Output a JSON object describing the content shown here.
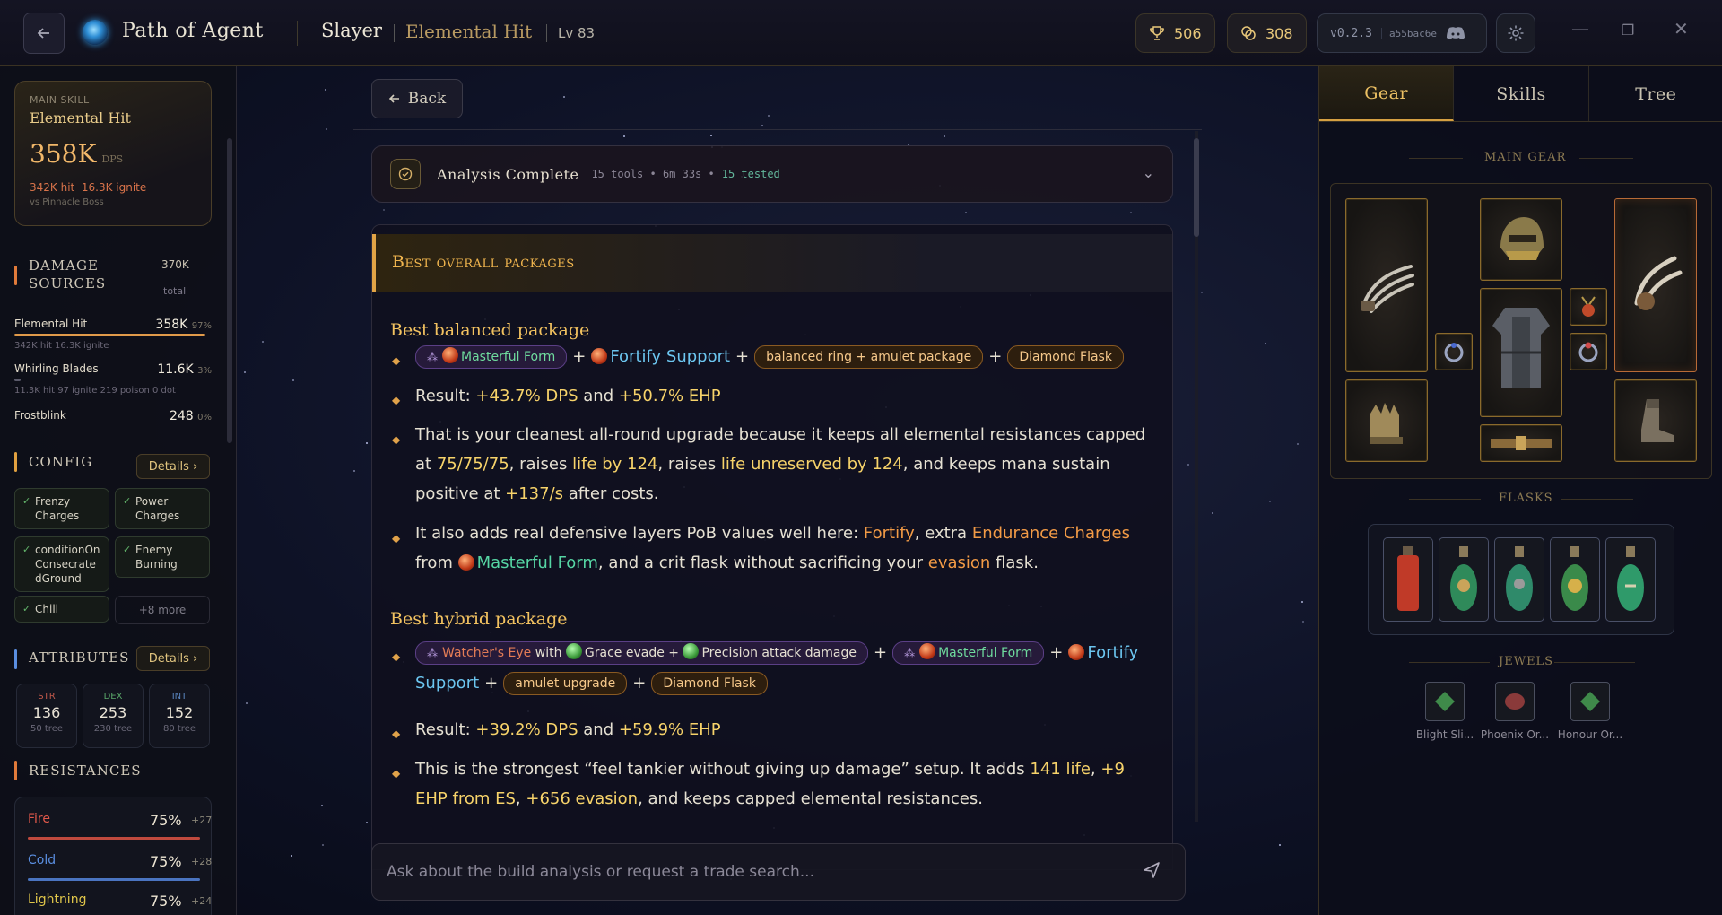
{
  "topbar": {
    "app_title": "Path of Agent",
    "class_name": "Slayer",
    "skill_name": "Elemental Hit",
    "level": "Lv 83",
    "trophy_count": "506",
    "coin_count": "308",
    "version": "v0.2.3",
    "hash": "a55bac6e",
    "icons": {
      "back": "arrow-left-icon",
      "trophy": "trophy-icon",
      "coins": "coins-icon",
      "discord": "discord-icon",
      "settings": "gear-icon"
    }
  },
  "sidebar": {
    "main_skill_label": "MAIN SKILL",
    "main_skill_name": "Elemental Hit",
    "dps_value": "358K",
    "dps_unit": "DPS",
    "hit_text": "342K hit",
    "ignite_text": "16.3K ignite",
    "vs_text": "vs Pinnacle Boss",
    "damage_sources_title": "Damage Sources",
    "damage_total_value": "370K",
    "damage_total_label": "total",
    "damage_sources": [
      {
        "name": "Elemental Hit",
        "value": "358K",
        "pct": "97%",
        "detail": "342K hit   16.3K ignite",
        "share": 0.97
      },
      {
        "name": "Whirling Blades",
        "value": "11.6K",
        "pct": "3%",
        "detail": "11.3K hit   97 ignite   219 poison   0 dot",
        "share": 0.03
      },
      {
        "name": "Frostblink",
        "value": "248",
        "pct": "0%",
        "detail": "",
        "share": 0.0
      }
    ],
    "config_title": "Config",
    "details_label": "Details",
    "config_chips": [
      "Frenzy Charges",
      "Power Charges",
      "conditionOnConsecratedGround",
      "Enemy Burning",
      "Chill"
    ],
    "config_more": "+8 more",
    "attributes_title": "Attributes",
    "attributes": [
      {
        "key": "STR",
        "value": "136",
        "tree": "50 tree",
        "color": "#c0584a"
      },
      {
        "key": "DEX",
        "value": "253",
        "tree": "230 tree",
        "color": "#5aa86a"
      },
      {
        "key": "INT",
        "value": "152",
        "tree": "80 tree",
        "color": "#5a86c0"
      }
    ],
    "resistances_title": "Resistances",
    "resistances": [
      {
        "name": "Fire",
        "value": "75%",
        "over": "+27",
        "color": "#e0584a"
      },
      {
        "name": "Cold",
        "value": "75%",
        "over": "+28",
        "color": "#5a8ee0"
      },
      {
        "name": "Lightning",
        "value": "75%",
        "over": "+24",
        "color": "#e0c64a"
      }
    ]
  },
  "center": {
    "back_label": "Back",
    "analysis_title": "Analysis Complete",
    "analysis_tools": "15 tools",
    "analysis_time": "6m 33s",
    "analysis_tested": "15 tested",
    "report_heading": "Best overall packages",
    "balanced_title": "Best balanced package",
    "balanced": {
      "node": "Masterful Form",
      "gem": "Fortify Support",
      "ring_chip": "balanced ring + amulet package",
      "flask_chip": "Diamond Flask",
      "result_prefix": "Result: ",
      "result_dps": "+43.7% DPS",
      "result_and": " and ",
      "result_ehp": "+50.7% EHP",
      "p1_a": "That is your cleanest all-round upgrade because it keeps all elemental resistances capped at ",
      "p1_res": "75/75/75",
      "p1_b": ", raises ",
      "p1_life": "life by 124",
      "p1_c": ", raises ",
      "p1_unres": "life unreserved by 124",
      "p1_d": ", and keeps mana sustain positive at ",
      "p1_mana": "+137/s",
      "p1_e": " after costs.",
      "p2_a": "It also adds real defensive layers PoB values well here: ",
      "p2_fortify": "Fortify",
      "p2_b": ", extra ",
      "p2_endur": "Endurance Charges",
      "p2_c": " from ",
      "p2_node": "Masterful Form",
      "p2_d": ", and a crit flask without sacrificing your ",
      "p2_evasion": "evasion",
      "p2_e": " flask."
    },
    "hybrid_title": "Best hybrid package",
    "hybrid": {
      "we_name": "Watcher's Eye",
      "we_with": "with",
      "we_grace": "Grace",
      "we_evade": "evade +",
      "we_precision": "Precision",
      "we_attack": "attack damage",
      "node": "Masterful Form",
      "gem": "Fortify Support",
      "amulet_chip": "amulet upgrade",
      "flask_chip": "Diamond Flask",
      "result_prefix": "Result: ",
      "result_dps": "+39.2% DPS",
      "result_and": " and ",
      "result_ehp": "+59.9% EHP",
      "p1_a": "This is the strongest “feel tankier without giving up damage” setup. It adds ",
      "p1_life": "141 life",
      "p1_b": ", ",
      "p1_es": "+9 EHP from ES",
      "p1_c": ", ",
      "p1_eva": "+656 evasion",
      "p1_d": ", and keeps capped elemental resistances."
    },
    "ask_placeholder": "Ask about the build analysis or request a trade search..."
  },
  "right": {
    "tabs": [
      "Gear",
      "Skills",
      "Tree"
    ],
    "main_gear_label": "MAIN GEAR",
    "flasks_label": "FLASKS",
    "jewels_label": "JEWELS",
    "gear_slots": [
      "weapon-claw",
      "helmet",
      "offhand-claw",
      "ring-left",
      "body-armour",
      "amulet",
      "ring-right",
      "gloves",
      "belt",
      "boots"
    ],
    "flasks": [
      "red-life-flask",
      "green-flask",
      "green-flask",
      "gold-green-flask",
      "green-flask"
    ],
    "jewels": [
      {
        "name": "Blight Sli...",
        "color": "#3f8a4a"
      },
      {
        "name": "Phoenix Or...",
        "color": "#8a3a3a"
      },
      {
        "name": "Honour Or...",
        "color": "#3f8a4a"
      }
    ],
    "colors": {
      "accent": "#d6a042",
      "unique": "#b86a36",
      "rare": "#8a6a2c"
    }
  }
}
